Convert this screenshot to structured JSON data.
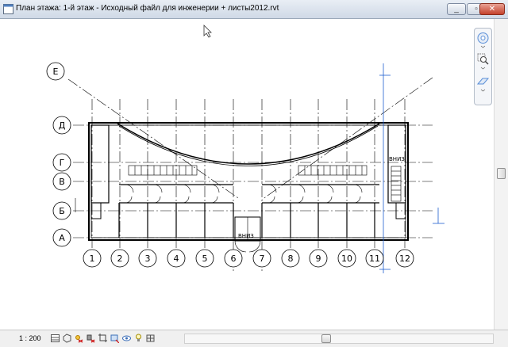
{
  "window": {
    "title": "План этажа: 1-й этаж - Исходный файл для инженерии + листы2012.rvt",
    "minimize_symbol": "_",
    "restore_symbol": "▫",
    "close_symbol": "✕"
  },
  "drawing": {
    "column_grids": [
      "1",
      "2",
      "3",
      "4",
      "5",
      "6",
      "7",
      "8",
      "9",
      "10",
      "11",
      "12"
    ],
    "row_grids": [
      "Д",
      "Г",
      "В",
      "Б",
      "А"
    ],
    "extra_grid": "Е",
    "stair_labels": [
      "ВНИЗ",
      "ВНИЗ"
    ]
  },
  "status": {
    "scale": "1 : 200"
  },
  "colors": {
    "titlebar_top": "#e9eef5",
    "dimension_blue": "#1f5fd0",
    "navbar_blue": "#5a8fd8"
  },
  "icons": {
    "view_controls": [
      "detail-level-icon",
      "visual-style-icon",
      "sun-path-icon",
      "shadows-icon",
      "crop-view-icon",
      "show-crop-icon",
      "temporary-hide-icon",
      "reveal-hidden-icon",
      "analytical-model-icon",
      "highlight-displacement-icon"
    ]
  }
}
